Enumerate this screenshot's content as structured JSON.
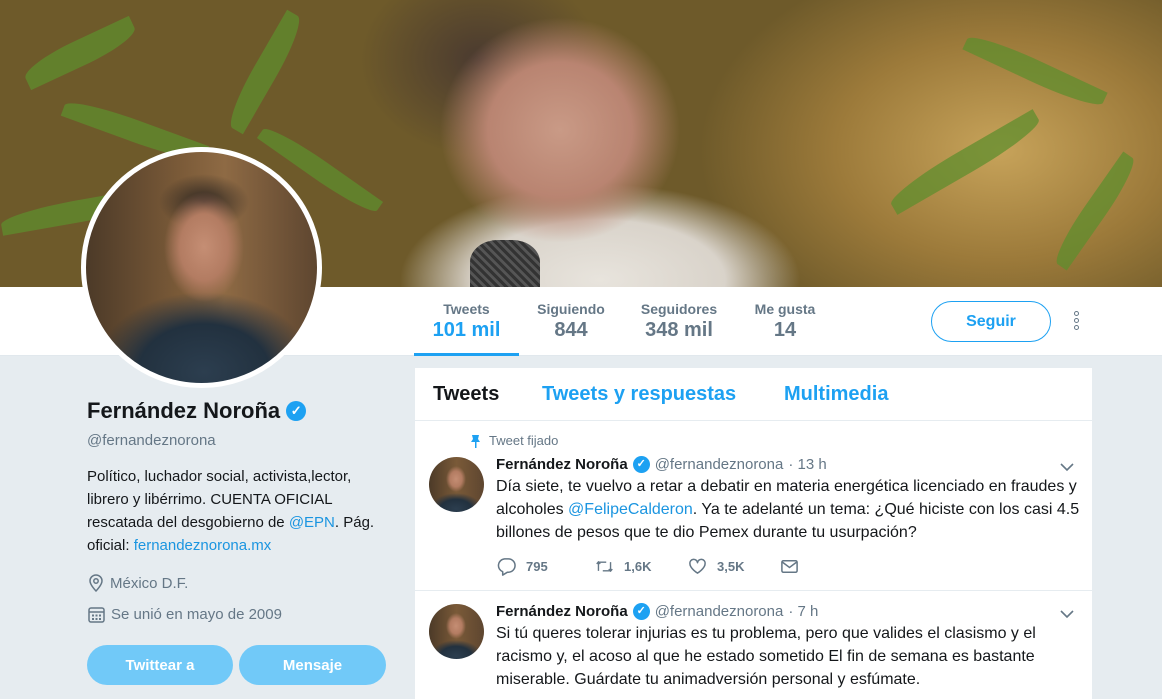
{
  "profile": {
    "name": "Fernández Noroña",
    "verified_mark": "✓",
    "handle": "@fernandeznorona",
    "bio_text_1": "Político, luchador social, activista,lector, librero y libérrimo. CUENTA OFICIAL rescatada del desgobierno de ",
    "bio_mention": "@EPN",
    "bio_text_2": ". Pág. oficial: ",
    "bio_link": "fernandeznorona.mx",
    "location": "México D.F.",
    "joined": "Se unió en mayo de 2009",
    "tweet_button": "Twittear a",
    "message_button": "Mensaje"
  },
  "nav": {
    "stats": [
      {
        "label": "Tweets",
        "value": "101 mil"
      },
      {
        "label": "Siguiendo",
        "value": "844"
      },
      {
        "label": "Seguidores",
        "value": "348 mil"
      },
      {
        "label": "Me gusta",
        "value": "14"
      }
    ],
    "follow_button": "Seguir"
  },
  "timeline": {
    "tabs": [
      "Tweets",
      "Tweets y respuestas",
      "Multimedia"
    ],
    "tweets": [
      {
        "pinned_label": "Tweet fijado",
        "name": "Fernández Noroña",
        "handle": "@fernandeznorona",
        "time": "· 13 h",
        "text_1": "Día siete, te vuelvo a retar a debatir en materia energética licenciado en fraudes y alcoholes ",
        "mention": "@FelipeCalderon",
        "text_2": ". Ya te adelanté un tema: ¿Qué hiciste con los casi 4.5 billones de pesos que te dio Pemex durante tu usurpación?",
        "replies": "795",
        "retweets": "1,6K",
        "likes": "3,5K"
      },
      {
        "name": "Fernández Noroña",
        "handle": "@fernandeznorona",
        "time": "· 7 h",
        "text": "Si tú queres tolerar injurias es tu problema, pero que valides el clasismo y el racismo y, el acoso al que he estado sometido El fin de semana es bastante miserable. Guárdate tu animadversión personal y esfúmate."
      }
    ]
  },
  "colors": {
    "accent": "#1da1f2",
    "link": "#1b95e0",
    "muted": "#657786",
    "background": "#e6ecf0",
    "button_light": "#71c9f8"
  },
  "icons": [
    "verified-badge-icon",
    "more-vertical-icon",
    "location-pin-icon",
    "calendar-icon",
    "pin-icon",
    "chevron-down-icon",
    "reply-icon",
    "retweet-icon",
    "like-heart-icon",
    "direct-message-icon"
  ]
}
